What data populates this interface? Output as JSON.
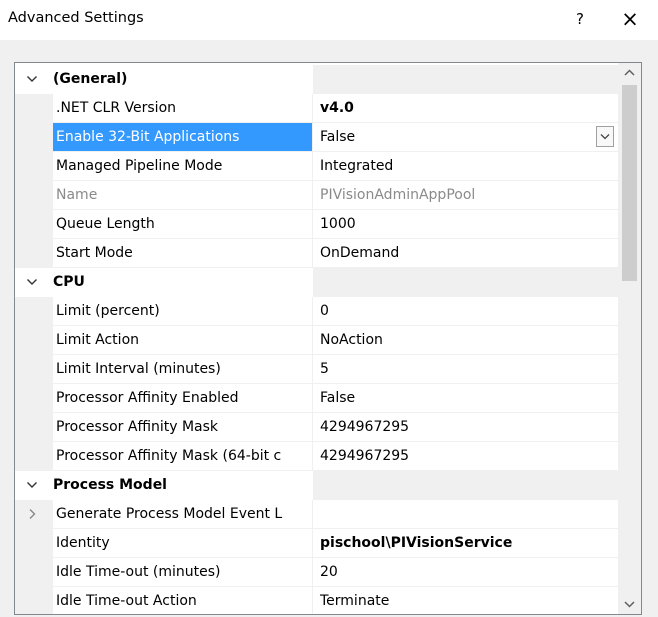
{
  "window": {
    "title": "Advanced Settings",
    "help_label": "?",
    "close_label": "×"
  },
  "categories": [
    {
      "name": "(General)",
      "expanded": true,
      "props": [
        {
          "name": ".NET CLR Version",
          "value": "v4.0",
          "bold": true
        },
        {
          "name": "Enable 32-Bit Applications",
          "value": "False",
          "selected": true,
          "dropdown": true
        },
        {
          "name": "Managed Pipeline Mode",
          "value": "Integrated"
        },
        {
          "name": "Name",
          "value": "PIVisionAdminAppPool",
          "disabled": true
        },
        {
          "name": "Queue Length",
          "value": "1000"
        },
        {
          "name": "Start Mode",
          "value": "OnDemand"
        }
      ]
    },
    {
      "name": "CPU",
      "expanded": true,
      "props": [
        {
          "name": "Limit (percent)",
          "value": "0"
        },
        {
          "name": "Limit Action",
          "value": "NoAction"
        },
        {
          "name": "Limit Interval (minutes)",
          "value": "5"
        },
        {
          "name": "Processor Affinity Enabled",
          "value": "False"
        },
        {
          "name": "Processor Affinity Mask",
          "value": "4294967295"
        },
        {
          "name": "Processor Affinity Mask (64-bit c",
          "value": "4294967295"
        }
      ]
    },
    {
      "name": "Process Model",
      "expanded": true,
      "props": [
        {
          "name": "Generate Process Model Event L",
          "value": "",
          "expandable": true
        },
        {
          "name": "Identity",
          "value": "pischool\\PIVisionService",
          "bold": true
        },
        {
          "name": "Idle Time-out (minutes)",
          "value": "20"
        },
        {
          "name": "Idle Time-out Action",
          "value": "Terminate"
        }
      ]
    }
  ],
  "scrollbar": {
    "position_fraction": 0.0,
    "visible_fraction": 0.36
  }
}
